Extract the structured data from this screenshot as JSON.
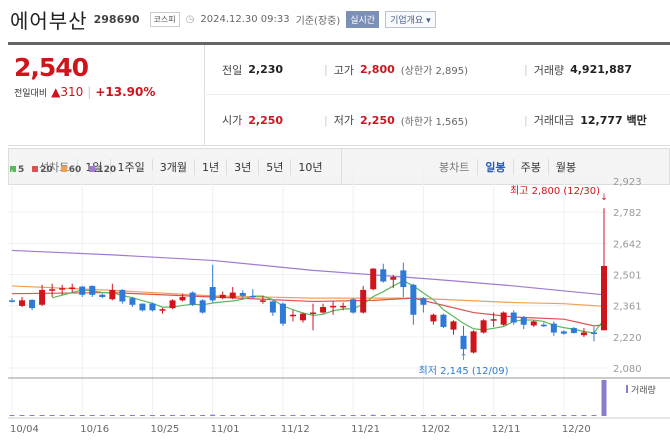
{
  "header": {
    "name": "에어부산",
    "code": "298690",
    "market": "코스피",
    "datetime": "2024.12.30 09:33",
    "basis": "기준(장중)",
    "realtime": "실시간",
    "corp_info": "기업개요 ▾"
  },
  "quote": {
    "price": "2,540",
    "change_label": "전일대비",
    "change": "310",
    "change_pct": "+13.90%",
    "prev_label": "전일",
    "prev": "2,230",
    "high_label": "고가",
    "high": "2,800",
    "upper_limit": "(상한가 2,895)",
    "volume_label": "거래량",
    "volume": "4,921,887",
    "open_label": "시가",
    "open": "2,250",
    "low_label": "저가",
    "low": "2,250",
    "lower_limit": "(하한가 1,565)",
    "amount_label": "거래대금",
    "amount": "12,777 백만"
  },
  "tabs": {
    "line_label": "선차트",
    "line": [
      "1일",
      "1주일",
      "3개월",
      "1년",
      "3년",
      "5년",
      "10년"
    ],
    "candle_label": "봉차트",
    "candle": [
      "일봉",
      "주봉",
      "월봉"
    ],
    "active_candle": "일봉"
  },
  "colors": {
    "up": "#d0141c",
    "down": "#2f7ad6",
    "ma5": "#5cb85c",
    "ma20": "#e05050",
    "ma60": "#f0a050",
    "ma120": "#a07ad0"
  },
  "chart_data": {
    "type": "candlestick",
    "legend": [
      "5",
      "20",
      "60",
      "120"
    ],
    "y_ticks": [
      "2,923",
      "2,782",
      "2,642",
      "2,501",
      "2,361",
      "2,220",
      "2,080"
    ],
    "ylim": [
      2080,
      2923
    ],
    "x_ticks": [
      {
        "i": 0,
        "label": "10/04"
      },
      {
        "i": 7,
        "label": "10/16"
      },
      {
        "i": 14,
        "label": "10/25"
      },
      {
        "i": 20,
        "label": "11/01"
      },
      {
        "i": 27,
        "label": "11/12"
      },
      {
        "i": 34,
        "label": "11/21"
      },
      {
        "i": 41,
        "label": "12/02"
      },
      {
        "i": 48,
        "label": "12/11"
      },
      {
        "i": 55,
        "label": "12/20"
      }
    ],
    "ohlc": [
      [
        2385,
        2395,
        2375,
        2380
      ],
      [
        2360,
        2400,
        2355,
        2385
      ],
      [
        2387,
        2390,
        2340,
        2350
      ],
      [
        2365,
        2455,
        2360,
        2432
      ],
      [
        2430,
        2460,
        2400,
        2435
      ],
      [
        2435,
        2455,
        2410,
        2440
      ],
      [
        2440,
        2460,
        2420,
        2443
      ],
      [
        2447,
        2450,
        2400,
        2410
      ],
      [
        2450,
        2452,
        2400,
        2410
      ],
      [
        2410,
        2415,
        2395,
        2400
      ],
      [
        2390,
        2460,
        2385,
        2432
      ],
      [
        2432,
        2435,
        2370,
        2380
      ],
      [
        2395,
        2400,
        2355,
        2365
      ],
      [
        2370,
        2372,
        2335,
        2340
      ],
      [
        2370,
        2375,
        2335,
        2340
      ],
      [
        2340,
        2350,
        2325,
        2345
      ],
      [
        2350,
        2390,
        2345,
        2385
      ],
      [
        2385,
        2415,
        2380,
        2400
      ],
      [
        2420,
        2425,
        2360,
        2365
      ],
      [
        2385,
        2390,
        2325,
        2330
      ],
      [
        2445,
        2545,
        2375,
        2385
      ],
      [
        2395,
        2425,
        2390,
        2410
      ],
      [
        2395,
        2445,
        2390,
        2420
      ],
      [
        2418,
        2430,
        2395,
        2405
      ],
      [
        2405,
        2435,
        2395,
        2400
      ],
      [
        2380,
        2405,
        2370,
        2385
      ],
      [
        2380,
        2385,
        2315,
        2330
      ],
      [
        2370,
        2375,
        2270,
        2280
      ],
      [
        2315,
        2340,
        2290,
        2320
      ],
      [
        2295,
        2330,
        2285,
        2325
      ],
      [
        2325,
        2370,
        2250,
        2330
      ],
      [
        2330,
        2370,
        2325,
        2355
      ],
      [
        2355,
        2380,
        2320,
        2360
      ],
      [
        2355,
        2375,
        2340,
        2360
      ],
      [
        2390,
        2395,
        2325,
        2330
      ],
      [
        2330,
        2450,
        2325,
        2432
      ],
      [
        2435,
        2530,
        2430,
        2528
      ],
      [
        2525,
        2550,
        2465,
        2470
      ],
      [
        2478,
        2500,
        2440,
        2490
      ],
      [
        2520,
        2555,
        2400,
        2445
      ],
      [
        2455,
        2460,
        2275,
        2320
      ],
      [
        2395,
        2400,
        2330,
        2365
      ],
      [
        2290,
        2325,
        2275,
        2320
      ],
      [
        2320,
        2325,
        2260,
        2265
      ],
      [
        2253,
        2295,
        2230,
        2290
      ],
      [
        2225,
        2270,
        2145,
        2165
      ],
      [
        2150,
        2250,
        2145,
        2245
      ],
      [
        2240,
        2300,
        2235,
        2295
      ],
      [
        2295,
        2330,
        2265,
        2300
      ],
      [
        2275,
        2335,
        2270,
        2330
      ],
      [
        2330,
        2340,
        2275,
        2285
      ],
      [
        2310,
        2315,
        2255,
        2275
      ],
      [
        2272,
        2295,
        2265,
        2290
      ],
      [
        2275,
        2285,
        2265,
        2270
      ],
      [
        2280,
        2290,
        2225,
        2240
      ],
      [
        2245,
        2250,
        2230,
        2235
      ],
      [
        2260,
        2265,
        2235,
        2238
      ],
      [
        2228,
        2260,
        2220,
        2240
      ],
      [
        2240,
        2265,
        2200,
        2238
      ],
      [
        2250,
        2800,
        2250,
        2540
      ]
    ],
    "volume": [
      40000,
      30000,
      60000,
      50000,
      40000,
      45000,
      50000,
      42000,
      38000,
      30000,
      45000,
      40000,
      30000,
      25000,
      30000,
      28000,
      30000,
      35000,
      30000,
      35000,
      180000,
      60000,
      80000,
      50000,
      45000,
      40000,
      50000,
      70000,
      45000,
      40000,
      45000,
      35000,
      40000,
      38000,
      40000,
      130000,
      170000,
      90000,
      70000,
      80000,
      75000,
      60000,
      70000,
      55000,
      60000,
      110000,
      70000,
      50000,
      45000,
      50000,
      40000,
      40000,
      45000,
      35000,
      40000,
      30000,
      30000,
      28000,
      30000,
      4921887
    ],
    "ma20": [
      [
        0,
        2415
      ],
      [
        10,
        2420
      ],
      [
        20,
        2400
      ],
      [
        30,
        2380
      ],
      [
        36,
        2385
      ],
      [
        40,
        2395
      ],
      [
        46,
        2330
      ],
      [
        50,
        2310
      ],
      [
        55,
        2300
      ],
      [
        58,
        2270
      ],
      [
        59,
        2275
      ]
    ],
    "ma60": [
      [
        0,
        2450
      ],
      [
        10,
        2430
      ],
      [
        20,
        2405
      ],
      [
        30,
        2395
      ],
      [
        40,
        2395
      ],
      [
        50,
        2375
      ],
      [
        55,
        2370
      ],
      [
        59,
        2358
      ]
    ],
    "ma120": [
      [
        0,
        2610
      ],
      [
        10,
        2590
      ],
      [
        20,
        2565
      ],
      [
        30,
        2520
      ],
      [
        36,
        2500
      ],
      [
        42,
        2480
      ],
      [
        50,
        2450
      ],
      [
        59,
        2410
      ]
    ],
    "annotations": {
      "max": "최고 2,800 (12/30)",
      "min": "최저 2,145 (12/09)",
      "volume_label": "거래량"
    }
  }
}
